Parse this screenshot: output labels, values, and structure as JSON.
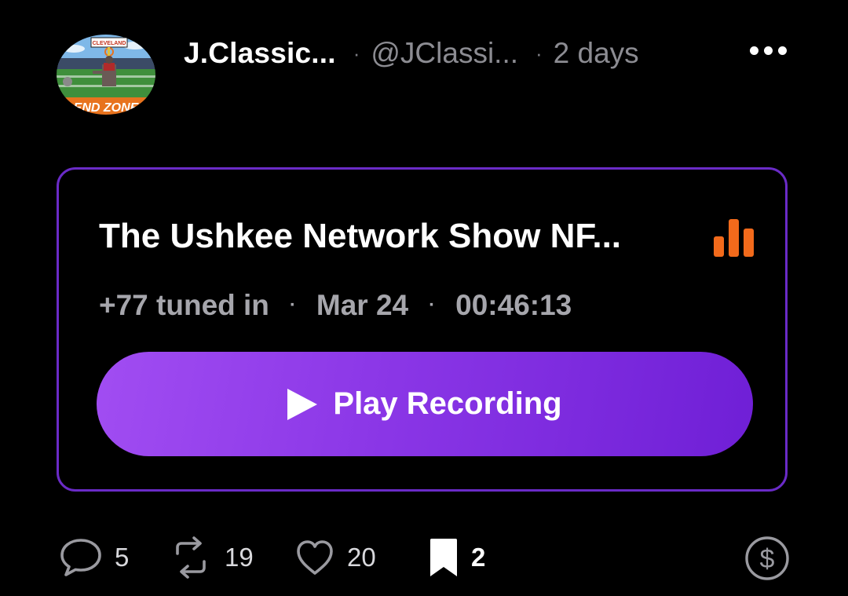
{
  "post": {
    "display_name": "J.Classic...",
    "separator": "·",
    "handle": "@JClassi...",
    "time": "2 days",
    "avatar": {
      "icon": "avatar-football-endzone",
      "banner_text": "CLEVELAND",
      "endzone_text": "END ZONE"
    }
  },
  "recording": {
    "title": "The Ushkee Network Show NF...",
    "tuned_in": "+77 tuned in",
    "date": "Mar 24",
    "duration": "00:46:13",
    "meta_separator": "·",
    "play_label": "Play Recording",
    "accent_color": "#6a2bc7",
    "bars_color": "#f26a1b"
  },
  "actions": {
    "replies": "5",
    "recasts": "19",
    "likes": "20",
    "bookmarks": "2"
  }
}
